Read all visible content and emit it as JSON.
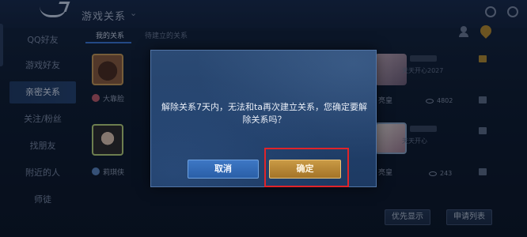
{
  "header": {
    "title": "游戏关系",
    "title_arrow": "⌄"
  },
  "tabs": [
    {
      "label": "我的关系",
      "active": true
    },
    {
      "label": "待建立的关系",
      "active": false
    }
  ],
  "search_hint": "",
  "sidebar": {
    "items": [
      {
        "label": "QQ好友",
        "active": false
      },
      {
        "label": "游戏好友",
        "active": false
      },
      {
        "label": "亲密关系",
        "active": true
      },
      {
        "label": "关注/粉丝",
        "active": false
      },
      {
        "label": "找朋友",
        "active": false
      },
      {
        "label": "附近的人",
        "active": false
      },
      {
        "label": "师徒",
        "active": false
      }
    ]
  },
  "rows": [
    {
      "relation": "大靠脸",
      "right_label": "亮皇",
      "count": "4802",
      "right_sub": "天天开心2027"
    },
    {
      "relation": "莉琪侠",
      "right_label": "亮皇",
      "count": "243",
      "right_sub": "天天开心"
    }
  ],
  "bottom": {
    "hint": "",
    "priority_button": "优先显示",
    "request_button": "申请列表"
  },
  "dialog": {
    "message": "解除关系7天内，无法和ta再次建立关系，您确定要解除关系吗？",
    "cancel_label": "取消",
    "confirm_label": "确定"
  },
  "colors": {
    "accent_blue": "#3a78d8",
    "confirm_gold": "#c99a45",
    "highlight_red": "#e0242a"
  }
}
